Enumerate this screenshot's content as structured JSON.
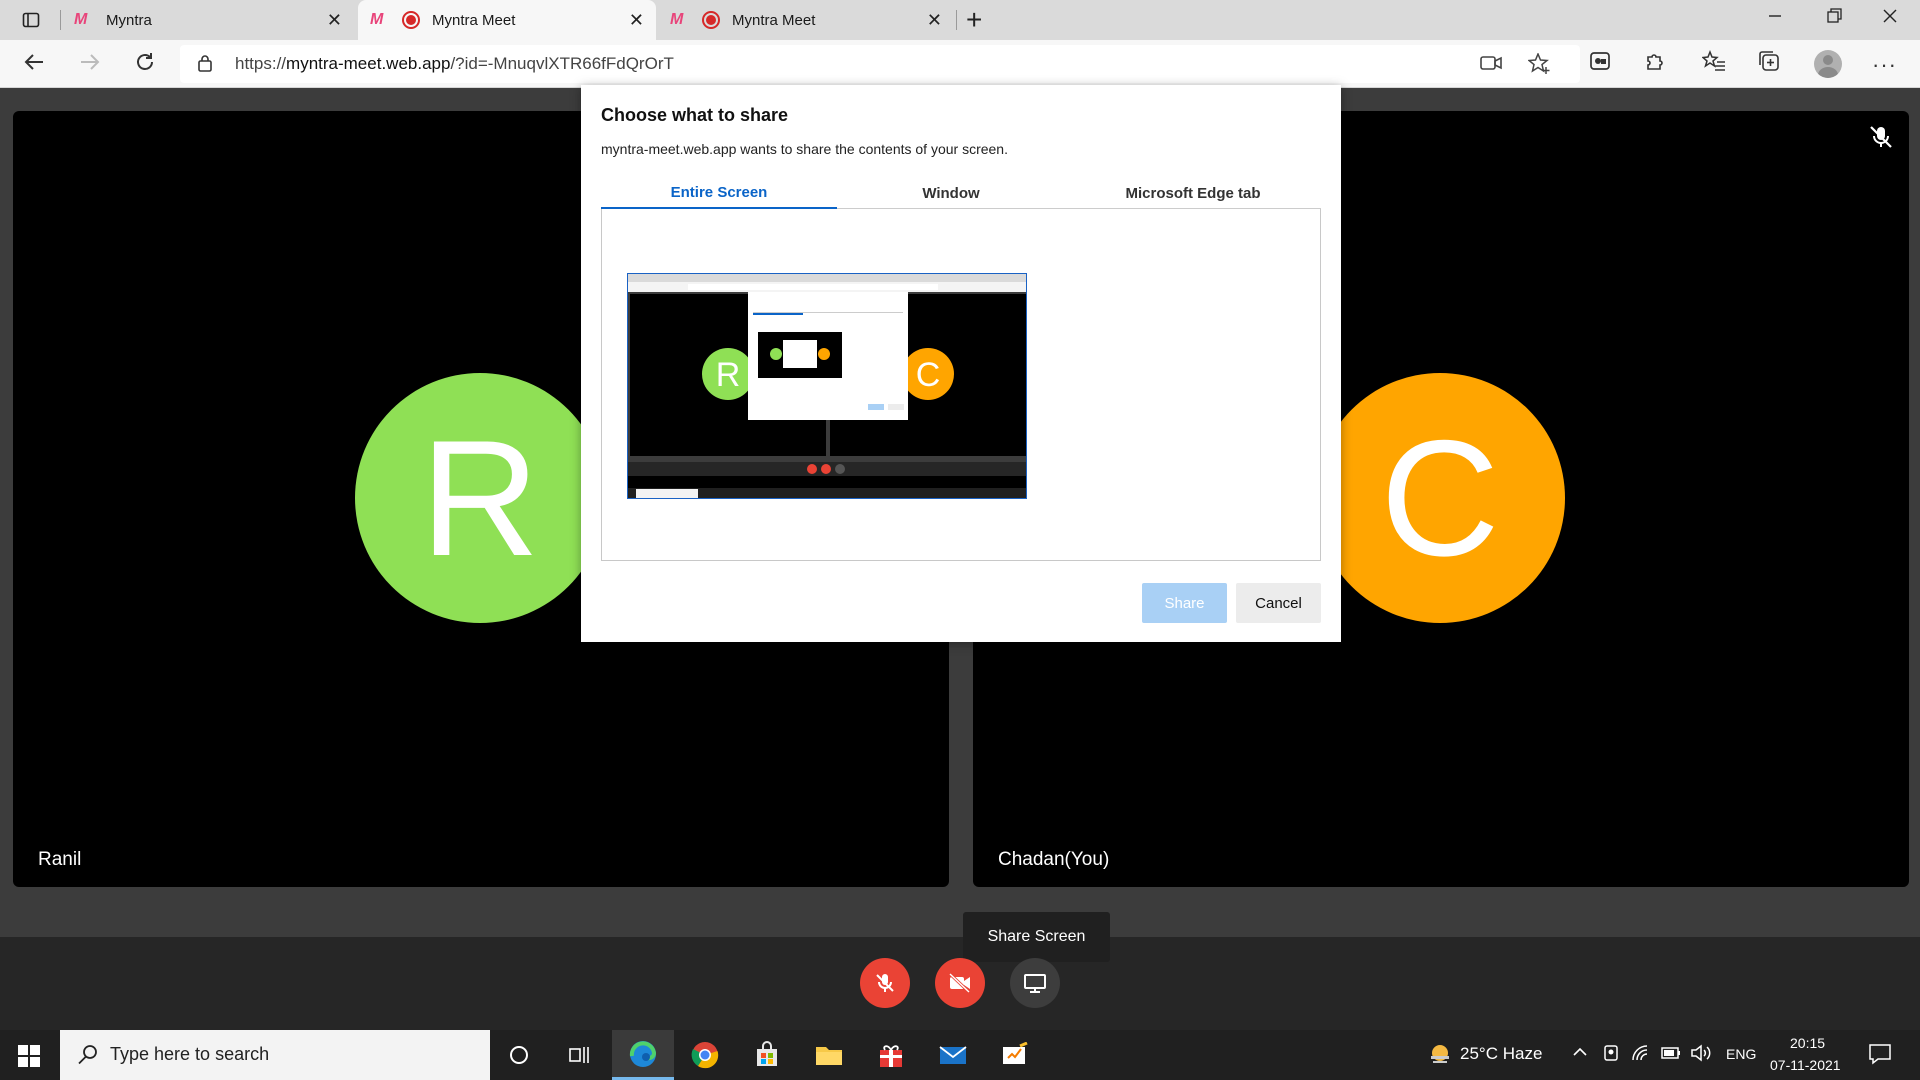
{
  "browser": {
    "tabs": [
      {
        "title": "Myntra",
        "active": false
      },
      {
        "title": "Myntra Meet",
        "active": true
      },
      {
        "title": "Myntra Meet",
        "active": false
      }
    ],
    "url_prefix": "https://",
    "url_host": "myntra-meet.web.app",
    "url_path": "/?id=-MnuqvlXTR66fFdQrOrT"
  },
  "meeting": {
    "participants": [
      {
        "name": "Ranil",
        "initial": "R",
        "color": "#8fe055"
      },
      {
        "name": "Chadan(You)",
        "initial": "C",
        "color": "#ffa500"
      }
    ],
    "tooltip": "Share Screen",
    "controls": [
      {
        "icon": "mic-off-icon",
        "color": "#ea4335"
      },
      {
        "icon": "video-off-icon",
        "color": "#ea4335"
      },
      {
        "icon": "monitor-icon",
        "color": "#3d3d3d"
      }
    ]
  },
  "share_dialog": {
    "title": "Choose what to share",
    "subtitle": "myntra-meet.web.app wants to share the contents of your screen.",
    "tabs": [
      "Entire Screen",
      "Window",
      "Microsoft Edge tab"
    ],
    "selected_tab": "Entire Screen",
    "share_label": "Share",
    "cancel_label": "Cancel"
  },
  "taskbar": {
    "search_placeholder": "Type here to search",
    "weather": "25°C  Haze",
    "language": "ENG",
    "time": "20:15",
    "date": "07-11-2021"
  }
}
